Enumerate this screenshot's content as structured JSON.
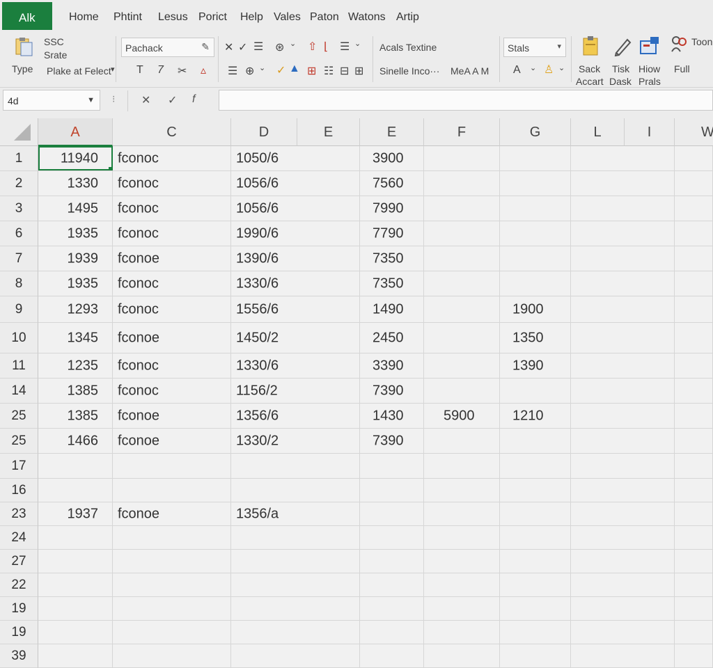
{
  "app": {
    "tab_label": "Alk",
    "accent": "#1b7f3e"
  },
  "menu": [
    "Home",
    "Phtint",
    "Lesus",
    "Porict",
    "Help",
    "Vales",
    "Paton",
    "Watons",
    "Artip"
  ],
  "ribbon": {
    "type_group": {
      "top": "SSC",
      "mid": "Srate",
      "bottom": "Type"
    },
    "font_box": "Pachack",
    "paste_select": "Plake at Felect",
    "align_text": "Acals Textine",
    "style_text": "Sinelle Inco···",
    "ma_text": "MeA A M",
    "stats_box": "Stals",
    "font_a": "A",
    "big_buttons": [
      {
        "label1": "Sack",
        "label2": "Accart",
        "icon": "clipboard-icon"
      },
      {
        "label1": "Tisk",
        "label2": "Dask",
        "icon": "pen-icon"
      },
      {
        "label1": "Hiow",
        "label2": "Prals",
        "icon": "window-icon"
      },
      {
        "label1": "Full",
        "label2": "",
        "icon": "people-icon"
      }
    ],
    "top_right": "Toon"
  },
  "formula_bar": {
    "name_box": "4d",
    "fx": "f",
    "input": ""
  },
  "columns": [
    "A",
    "C",
    "D",
    "E",
    "E",
    "F",
    "G",
    "L",
    "I",
    "W"
  ],
  "rows": [
    {
      "n": "1",
      "a": "11940",
      "c": "fconoc",
      "d": "1050/6",
      "e": "3900",
      "f": "",
      "g": ""
    },
    {
      "n": "2",
      "a": "1330",
      "c": "fconoc",
      "d": "1056/6",
      "e": "7560",
      "f": "",
      "g": ""
    },
    {
      "n": "3",
      "a": "1495",
      "c": "fconoc",
      "d": "1056/6",
      "e": "7990",
      "f": "",
      "g": ""
    },
    {
      "n": "6",
      "a": "1935",
      "c": "fconoc",
      "d": "1990/6",
      "e": "7790",
      "f": "",
      "g": ""
    },
    {
      "n": "7",
      "a": "1939",
      "c": "fconoe",
      "d": "1390/6",
      "e": "7350",
      "f": "",
      "g": ""
    },
    {
      "n": "8",
      "a": "1935",
      "c": "fconoc",
      "d": "1330/6",
      "e": "7350",
      "f": "",
      "g": ""
    },
    {
      "n": "9",
      "a": "1293",
      "c": "fconoc",
      "d": "1556/6",
      "e": "1490",
      "f": "",
      "g": "1900"
    },
    {
      "n": "10",
      "a": "1345",
      "c": "fconoe",
      "d": "1450/2",
      "e": "2450",
      "f": "",
      "g": "1350"
    },
    {
      "n": "11",
      "a": "1235",
      "c": "fconoc",
      "d": "1330/6",
      "e": "3390",
      "f": "",
      "g": "1390"
    },
    {
      "n": "14",
      "a": "1385",
      "c": "fconoc",
      "d": "1156/2",
      "e": "7390",
      "f": "",
      "g": ""
    },
    {
      "n": "25",
      "a": "1385",
      "c": "fconoe",
      "d": "1356/6",
      "e": "1430",
      "f": "5900",
      "g": "1210"
    },
    {
      "n": "25",
      "a": "1466",
      "c": "fconoe",
      "d": "1330/2",
      "e": "7390",
      "f": "",
      "g": ""
    },
    {
      "n": "17",
      "a": "",
      "c": "",
      "d": "",
      "e": "",
      "f": "",
      "g": ""
    },
    {
      "n": "16",
      "a": "",
      "c": "",
      "d": "",
      "e": "",
      "f": "",
      "g": ""
    },
    {
      "n": "23",
      "a": "1937",
      "c": "fconoe",
      "d": "1356/a",
      "e": "",
      "f": "",
      "g": ""
    },
    {
      "n": "24",
      "a": "",
      "c": "",
      "d": "",
      "e": "",
      "f": "",
      "g": ""
    },
    {
      "n": "27",
      "a": "",
      "c": "",
      "d": "",
      "e": "",
      "f": "",
      "g": ""
    },
    {
      "n": "22",
      "a": "",
      "c": "",
      "d": "",
      "e": "",
      "f": "",
      "g": ""
    },
    {
      "n": "19",
      "a": "",
      "c": "",
      "d": "",
      "e": "",
      "f": "",
      "g": ""
    },
    {
      "n": "19",
      "a": "",
      "c": "",
      "d": "",
      "e": "",
      "f": "",
      "g": ""
    },
    {
      "n": "39",
      "a": "",
      "c": "",
      "d": "",
      "e": "",
      "f": "",
      "g": ""
    }
  ]
}
